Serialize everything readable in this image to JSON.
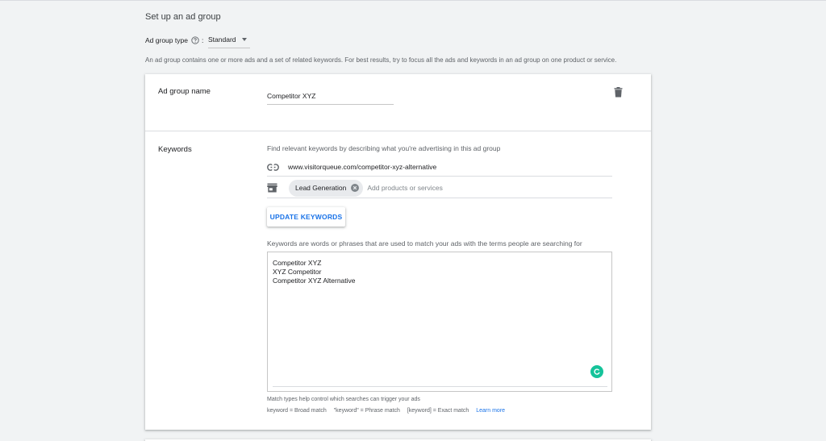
{
  "section_title": "Set up an ad group",
  "ad_group_type": {
    "label": "Ad group type",
    "help_icon": "help-circle-icon",
    "colon": ":",
    "value": "Standard"
  },
  "intro_text": "An ad group contains one or more ads and a set of related keywords. For best results, try to focus all the ads and keywords in an ad group on one product or service.",
  "ad_group_name": {
    "label": "Ad group name",
    "value": "Competitor XYZ",
    "delete_icon": "trash-icon"
  },
  "keywords": {
    "label": "Keywords",
    "hint": "Find relevant keywords by describing what you're advertising in this ad group",
    "url": "www.visitorqueue.com/competitor-xyz-alternative",
    "url_icon": "link-icon",
    "product_icon": "store-icon",
    "chip": "Lead Generation",
    "product_placeholder": "Add products or services",
    "update_button": "UPDATE KEYWORDS",
    "description": "Keywords are words or phrases that are used to match your ads with the terms people are searching for",
    "list": [
      "Competitor XYZ",
      "XYZ Competitor",
      "Competitor XYZ Alternative"
    ],
    "match_note": "Match types help control which searches can trigger your ads",
    "broad": "keyword = Broad match",
    "phrase": "\"keyword\" = Phrase match",
    "exact": "[keyword] = Exact match",
    "learn_more": "Learn more"
  },
  "colors": {
    "accent": "#1a73e8",
    "grammarly": "#15c39a",
    "background": "#f1f3f4"
  }
}
